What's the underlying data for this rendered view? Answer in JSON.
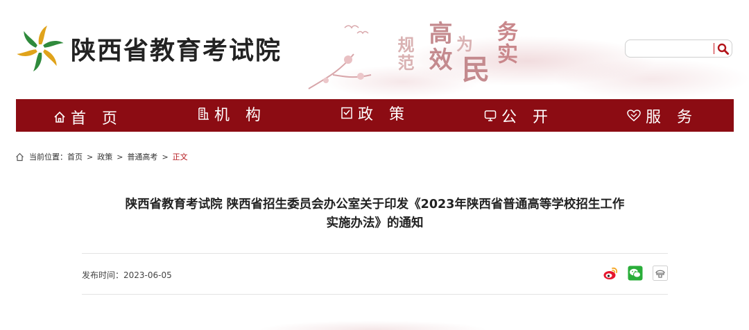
{
  "header": {
    "site_name": "陕西省教育考试院",
    "slogan": [
      "规范",
      "高效",
      "为",
      "民",
      "务实"
    ]
  },
  "search": {
    "value": "",
    "placeholder": ""
  },
  "nav": {
    "items": [
      {
        "label": "首 页",
        "icon": "home-icon"
      },
      {
        "label": "机 构",
        "icon": "building-icon"
      },
      {
        "label": "政 策",
        "icon": "policy-icon"
      },
      {
        "label": "公 开",
        "icon": "monitor-icon"
      },
      {
        "label": "服 务",
        "icon": "heart-icon"
      }
    ]
  },
  "breadcrumb": {
    "prefix": "当前位置：",
    "items": [
      "首页",
      "政策",
      "普通高考"
    ],
    "separator": ">",
    "current": "正文"
  },
  "article": {
    "title_line1": "陕西省教育考试院 陕西省招生委员会办公室关于印发《2023年陕西省普通高等学校招生工作",
    "title_line2": "实施办法》的通知",
    "publish_label": "发布时间：",
    "publish_date": "2023-06-05"
  },
  "share": {
    "icons": [
      "weibo-icon",
      "wechat-icon",
      "more-share-icon"
    ]
  },
  "colors": {
    "nav_background": "#8c0c13",
    "accent_red": "#b3141a",
    "rule_gray": "#e3e3e3"
  }
}
